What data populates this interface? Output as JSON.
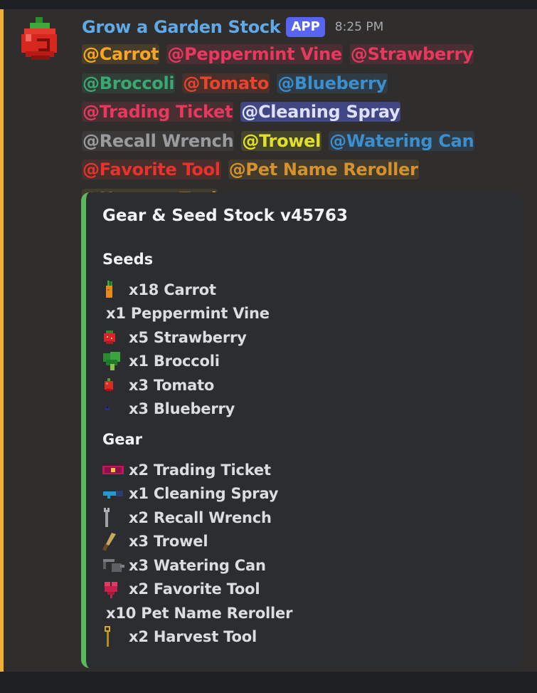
{
  "colors": {
    "background": "#2f2e2c",
    "accent_bar": "#f0b232",
    "embed_border": "#5cb85c",
    "username": "#5fa9e8",
    "app_badge": "#5865f2"
  },
  "message": {
    "author": "Grow a Garden Stock",
    "badge": "APP",
    "timestamp": "8:25 PM",
    "avatar_icon": "red-pepper-icon",
    "mentions": [
      {
        "text": "@Carrot",
        "color": "#f5a623",
        "bg": "rgba(245,166,35,0.13)"
      },
      {
        "text": "@Peppermint Vine",
        "color": "#e8385f",
        "bg": "rgba(232,56,95,0.14)"
      },
      {
        "text": "@Strawberry",
        "color": "#e8385f",
        "bg": "rgba(232,56,95,0.14)"
      },
      {
        "text": "@Broccoli",
        "color": "#3aa872",
        "bg": "rgba(58,168,114,0.13)"
      },
      {
        "text": "@Tomato",
        "color": "#e8432c",
        "bg": "rgba(232,67,44,0.14)"
      },
      {
        "text": "@Blueberry",
        "color": "#3a8fd1",
        "bg": "rgba(58,143,209,0.14)"
      },
      {
        "text": "@Trading Ticket",
        "color": "#e8385f",
        "bg": "rgba(232,56,95,0.14)"
      },
      {
        "text": "@Cleaning Spray",
        "color": "#dde0ff",
        "bg": "rgba(88,101,242,0.45)"
      },
      {
        "text": "@Recall Wrench",
        "color": "#9a9b9f",
        "bg": "rgba(154,155,159,0.10)"
      },
      {
        "text": "@Trowel",
        "color": "#e3e02a",
        "bg": "rgba(227,224,42,0.13)"
      },
      {
        "text": "@Watering Can",
        "color": "#3a8fd1",
        "bg": "rgba(58,143,209,0.14)"
      },
      {
        "text": "@Favorite Tool",
        "color": "#e8322c",
        "bg": "rgba(232,50,44,0.14)"
      },
      {
        "text": "@Pet Name Reroller",
        "color": "#d4922f",
        "bg": "rgba(212,146,47,0.13)"
      },
      {
        "text": "@Harvest Tool",
        "color": "#d4922f",
        "bg": "rgba(212,146,47,0.13)"
      }
    ]
  },
  "embed": {
    "title": "Gear & Seed Stock v45763",
    "seeds_title": "Seeds",
    "seeds": [
      {
        "text": "x18 Carrot",
        "icon": "carrot-icon"
      },
      {
        "text": "x1 Peppermint Vine",
        "icon": ""
      },
      {
        "text": "x5 Strawberry",
        "icon": "strawberry-icon"
      },
      {
        "text": "x1 Broccoli",
        "icon": "broccoli-icon"
      },
      {
        "text": "x3 Tomato",
        "icon": "tomato-icon"
      },
      {
        "text": "x3 Blueberry",
        "icon": "blueberry-icon"
      }
    ],
    "gear_title": "Gear",
    "gear": [
      {
        "text": "x2 Trading Ticket",
        "icon": "ticket-icon"
      },
      {
        "text": "x1 Cleaning Spray",
        "icon": "spray-icon"
      },
      {
        "text": "x2 Recall Wrench",
        "icon": "wrench-icon"
      },
      {
        "text": "x3 Trowel",
        "icon": "trowel-icon"
      },
      {
        "text": "x3 Watering Can",
        "icon": "watering-can-icon"
      },
      {
        "text": "x2 Favorite Tool",
        "icon": "heart-tool-icon"
      },
      {
        "text": "x10 Pet Name Reroller",
        "icon": ""
      },
      {
        "text": "x2 Harvest Tool",
        "icon": "harvest-tool-icon"
      }
    ]
  }
}
